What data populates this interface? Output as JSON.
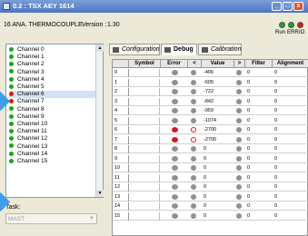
{
  "window": {
    "title": "0.2 : TSX AEY 1614",
    "minimize": "_",
    "maximize": "□",
    "close": "x"
  },
  "header": {
    "module": "16 ANA. THERMOCOUPLE",
    "version_label": "Version :",
    "version_value": "1.30",
    "leds": [
      {
        "label": "Run",
        "color": "#1aa51a"
      },
      {
        "label": "ERR",
        "color": "#1aa51a"
      },
      {
        "label": "IO",
        "color": "#d81818"
      }
    ]
  },
  "channels": [
    {
      "label": "Channel 0",
      "status": "#1aa51a"
    },
    {
      "label": "Channel 1",
      "status": "#1aa51a"
    },
    {
      "label": "Channel 2",
      "status": "#1aa51a"
    },
    {
      "label": "Channel 3",
      "status": "#1aa51a"
    },
    {
      "label": "Channel 4",
      "status": "#1aa51a"
    },
    {
      "label": "Channel 5",
      "status": "#1aa51a"
    },
    {
      "label": "Channel 6",
      "status": "#d41a1a",
      "selected": true
    },
    {
      "label": "Channel 7",
      "status": "#d41a1a"
    },
    {
      "label": "Channel 8",
      "status": "#1aa51a"
    },
    {
      "label": "Channel 9",
      "status": "#1aa51a"
    },
    {
      "label": "Channel 10",
      "status": "#1aa51a"
    },
    {
      "label": "Channel 11",
      "status": "#1aa51a"
    },
    {
      "label": "Channel 12",
      "status": "#1aa51a"
    },
    {
      "label": "Channel 13",
      "status": "#1aa51a"
    },
    {
      "label": "Channel 14",
      "status": "#1aa51a"
    },
    {
      "label": "Channel 15",
      "status": "#1aa51a"
    }
  ],
  "task": {
    "label": "Task:",
    "value": "MAST"
  },
  "tabs": [
    {
      "label": "Configuration"
    },
    {
      "label": "Debug"
    },
    {
      "label": "Calibration"
    }
  ],
  "table": {
    "headers": [
      "",
      "Symbol",
      "Error",
      "<",
      "Value",
      ">",
      "Filter",
      "Alignment"
    ],
    "rows": [
      {
        "n": "0",
        "error": "gray",
        "lt": "gray",
        "value": "-406",
        "filter": "0",
        "align": "0"
      },
      {
        "n": "1",
        "error": "gray",
        "lt": "gray",
        "value": "-605",
        "filter": "0",
        "align": "0"
      },
      {
        "n": "2",
        "error": "gray",
        "lt": "gray",
        "value": "-722",
        "filter": "0",
        "align": "0"
      },
      {
        "n": "3",
        "error": "gray",
        "lt": "gray",
        "value": "-842",
        "filter": "0",
        "align": "0"
      },
      {
        "n": "4",
        "error": "gray",
        "lt": "gray",
        "value": "-959",
        "filter": "0",
        "align": "0"
      },
      {
        "n": "5",
        "error": "gray",
        "lt": "gray",
        "value": "-1074",
        "filter": "0",
        "align": "0"
      },
      {
        "n": "6",
        "error": "red",
        "lt": "redring",
        "value": "-2700",
        "filter": "0",
        "align": "0"
      },
      {
        "n": "7",
        "error": "red",
        "lt": "redring",
        "value": "-2700",
        "filter": "0",
        "align": "0"
      },
      {
        "n": "8",
        "error": "gray",
        "lt": "gray",
        "value": "0",
        "filter": "0",
        "align": "0"
      },
      {
        "n": "9",
        "error": "gray",
        "lt": "gray",
        "value": "0",
        "filter": "0",
        "align": "0"
      },
      {
        "n": "10",
        "error": "gray",
        "lt": "gray",
        "value": "0",
        "filter": "0",
        "align": "0"
      },
      {
        "n": "11",
        "error": "gray",
        "lt": "gray",
        "value": "0",
        "filter": "0",
        "align": "0"
      },
      {
        "n": "12",
        "error": "gray",
        "lt": "gray",
        "value": "0",
        "filter": "0",
        "align": "0"
      },
      {
        "n": "13",
        "error": "gray",
        "lt": "gray",
        "value": "0",
        "filter": "0",
        "align": "0"
      },
      {
        "n": "14",
        "error": "gray",
        "lt": "gray",
        "value": "0",
        "filter": "0",
        "align": "0"
      },
      {
        "n": "15",
        "error": "gray",
        "lt": "gray",
        "value": "0",
        "filter": "0",
        "align": "0"
      }
    ]
  }
}
